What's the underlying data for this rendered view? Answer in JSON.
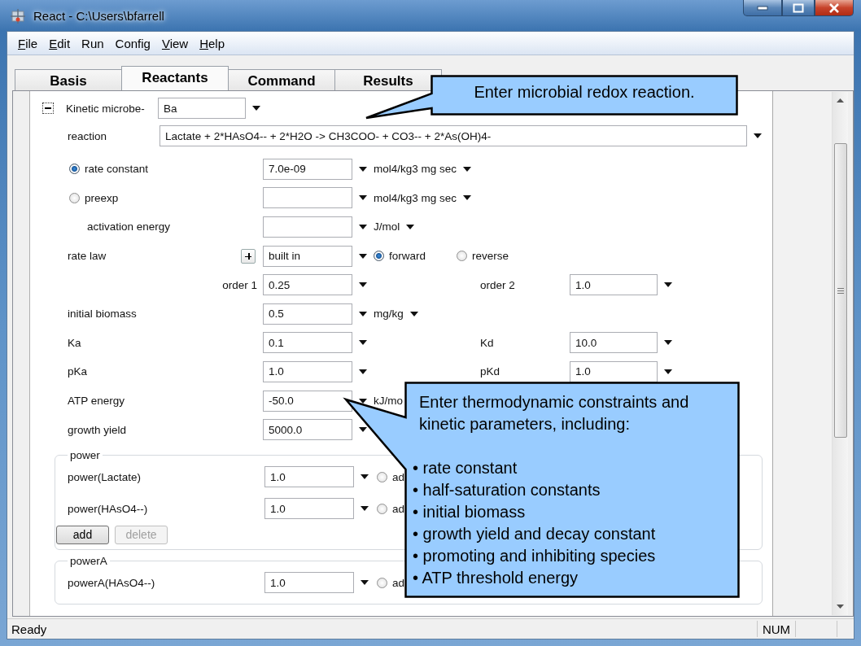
{
  "window": {
    "title": "React - C:\\Users\\bfarrell"
  },
  "menu": [
    {
      "label": "File",
      "mnemonic": true
    },
    {
      "label": "Edit",
      "mnemonic": true
    },
    {
      "label": "Run",
      "mnemonic": false
    },
    {
      "label": "Config",
      "mnemonic": false
    },
    {
      "label": "View",
      "mnemonic": true
    },
    {
      "label": "Help",
      "mnemonic": true
    }
  ],
  "tabs": [
    {
      "label": "Basis",
      "selected": false
    },
    {
      "label": "Reactants",
      "selected": true
    },
    {
      "label": "Command",
      "selected": false
    },
    {
      "label": "Results",
      "selected": false
    }
  ],
  "form": {
    "microbe": {
      "label": "Kinetic microbe-",
      "value": "Ba",
      "expanded": true
    },
    "reaction": {
      "label": "reaction",
      "value": "Lactate  + 2*HAsO4--  + 2*H2O  -> CH3COO-  + CO3--  + 2*As(OH)4-"
    },
    "rows": [
      {
        "kind": "radio",
        "label": "rate constant",
        "selected": true,
        "value": "7.0e-09",
        "unit": "mol4/kg3 mg sec",
        "unit_caret": true
      },
      {
        "kind": "radio",
        "label": "preexp",
        "selected": false,
        "unit": "mol4/kg3 mg sec",
        "unit_caret": true
      },
      {
        "kind": "indented",
        "label": "activation energy",
        "unit": "J/mol",
        "unit_caret": true
      },
      {
        "kind": "rate_law",
        "label": "rate law",
        "expanded": false,
        "value": "built in",
        "options": [
          {
            "label": "forward",
            "selected": true
          },
          {
            "label": "reverse",
            "selected": false
          }
        ]
      },
      {
        "kind": "sub",
        "label": "order 1",
        "value": "0.25",
        "right_label": "order 2",
        "right_value": "1.0"
      },
      {
        "kind": "plain",
        "label": "initial biomass",
        "value": "0.5",
        "unit": "mg/kg",
        "unit_caret": true
      },
      {
        "kind": "plain",
        "label": "Ka",
        "value": "0.1",
        "right_label": "Kd",
        "right_value": "10.0"
      },
      {
        "kind": "plain",
        "label": "pKa",
        "value": "1.0",
        "right_label": "pKd",
        "right_value": "1.0"
      },
      {
        "kind": "plain",
        "label": "ATP energy",
        "value": "-50.0",
        "unit": "kJ/mo"
      },
      {
        "kind": "plain",
        "label": "growth yield",
        "value": "5000.0"
      }
    ]
  },
  "groups": [
    {
      "title": "power",
      "rows": [
        {
          "label": "power(Lactate)",
          "value": "1.0",
          "option": {
            "label": "ad",
            "selected": false
          }
        },
        {
          "label": "power(HAsO4--)",
          "value": "1.0",
          "option": {
            "label": "ad",
            "selected": false
          }
        }
      ],
      "buttons": [
        {
          "label": "add",
          "disabled": false
        },
        {
          "label": "delete",
          "disabled": true
        }
      ]
    },
    {
      "title": "powerA",
      "rows": [
        {
          "label": "powerA(HAsO4--)",
          "value": "1.0",
          "option": {
            "label": "ad",
            "selected": false
          }
        }
      ]
    }
  ],
  "callouts": [
    {
      "kind": "single",
      "text": "Enter microbial redox reaction."
    },
    {
      "kind": "list",
      "intro": "Enter thermodynamic constraints and kinetic parameters, including:",
      "items": [
        "• rate constant",
        "• half-saturation constants",
        "• initial biomass",
        "• growth yield and decay constant",
        "• promoting and inhibiting species",
        "• ATP threshold energy"
      ]
    }
  ],
  "status_bar": {
    "text": "Ready",
    "indicator": "NUM"
  }
}
